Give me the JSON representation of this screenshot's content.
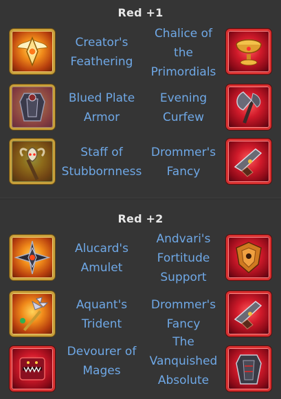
{
  "sections": [
    {
      "title": "Red +1",
      "rows": [
        {
          "left": {
            "name": "Creator's Feathering",
            "icon": "winged-amulet-icon"
          },
          "right": {
            "name": "Chalice of the Primordials",
            "icon": "chalice-icon"
          }
        },
        {
          "left": {
            "name": "Blued Plate Armor",
            "icon": "plate-armor-icon"
          },
          "right": {
            "name": "Evening Curfew",
            "icon": "axe-icon"
          }
        },
        {
          "left": {
            "name": "Staff of Stubbornness",
            "icon": "horned-staff-icon"
          },
          "right": {
            "name": "Drommer's Fancy",
            "icon": "pistol-icon"
          }
        }
      ]
    },
    {
      "title": "Red +2",
      "rows": [
        {
          "left": {
            "name": "Alucard's Amulet",
            "icon": "spiked-amulet-icon"
          },
          "right": {
            "name": "Andvari's Fortitude Support",
            "icon": "shield-support-icon"
          }
        },
        {
          "left": {
            "name": "Aquant's Trident",
            "icon": "trident-icon"
          },
          "right": {
            "name": "Drommer's Fancy",
            "icon": "pistol-icon"
          }
        },
        {
          "left": {
            "name": "Devourer of Mages",
            "icon": "fanged-tome-icon"
          },
          "right": {
            "name": "The Vanquished Absolute",
            "icon": "dark-armor-icon"
          }
        }
      ]
    }
  ]
}
